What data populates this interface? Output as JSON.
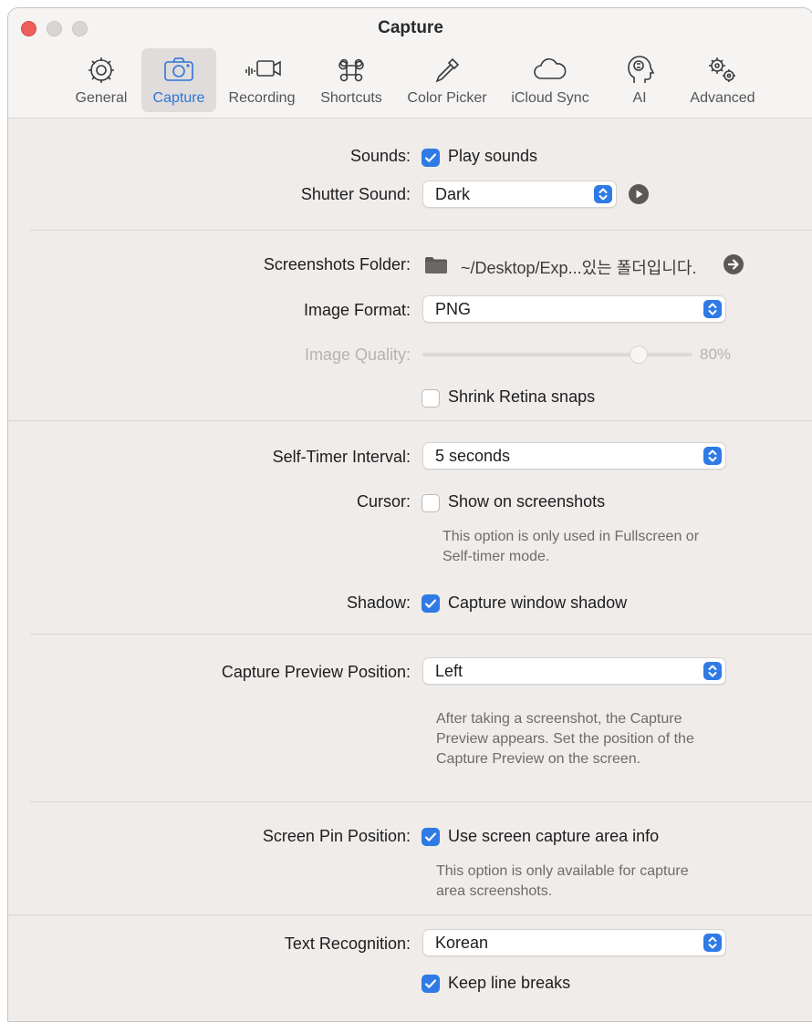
{
  "window": {
    "title": "Capture"
  },
  "tabs": [
    {
      "label": "General",
      "icon": "gear-icon"
    },
    {
      "label": "Capture",
      "icon": "camera-icon",
      "active": true
    },
    {
      "label": "Recording",
      "icon": "video-camera-icon"
    },
    {
      "label": "Shortcuts",
      "icon": "command-icon"
    },
    {
      "label": "Color Picker",
      "icon": "eyedropper-icon"
    },
    {
      "label": "iCloud Sync",
      "icon": "cloud-icon"
    },
    {
      "label": "AI",
      "icon": "head-brain-icon"
    },
    {
      "label": "Advanced",
      "icon": "gears-icon"
    }
  ],
  "sounds": {
    "label": "Sounds:",
    "checkbox_label": "Play sounds",
    "checked": true
  },
  "shutter_sound": {
    "label": "Shutter Sound:",
    "value": "Dark"
  },
  "screenshots_folder": {
    "label": "Screenshots Folder:",
    "path": "~/Desktop/Exp...있는 폴더입니다."
  },
  "image_format": {
    "label": "Image Format:",
    "value": "PNG"
  },
  "image_quality": {
    "label": "Image Quality:",
    "value_text": "80%",
    "value": 0.8,
    "enabled": false
  },
  "shrink_retina": {
    "checkbox_label": "Shrink Retina snaps",
    "checked": false
  },
  "self_timer": {
    "label": "Self-Timer Interval:",
    "value": "5 seconds"
  },
  "cursor": {
    "label": "Cursor:",
    "checkbox_label": "Show on screenshots",
    "checked": false,
    "note_line1": "This option is only used in Fullscreen or",
    "note_line2": "Self-timer mode."
  },
  "shadow": {
    "label": "Shadow:",
    "checkbox_label": "Capture window shadow",
    "checked": true
  },
  "preview_position": {
    "label": "Capture Preview Position:",
    "value": "Left",
    "note_line1": "After taking a screenshot, the Capture",
    "note_line2": "Preview appears. Set the position of the",
    "note_line3": "Capture Preview on the screen."
  },
  "screen_pin": {
    "label": "Screen Pin Position:",
    "checkbox_label": "Use screen capture area info",
    "checked": true,
    "note_line1": "This option is  only available for capture",
    "note_line2": "area screenshots."
  },
  "text_recognition": {
    "label": "Text Recognition:",
    "value": "Korean",
    "line_breaks_label": "Keep line breaks",
    "line_breaks_checked": true
  },
  "colors": {
    "accent": "#2f7ae5",
    "active_tab_text": "#2f74d6",
    "close_button": "#ec5f5b"
  }
}
